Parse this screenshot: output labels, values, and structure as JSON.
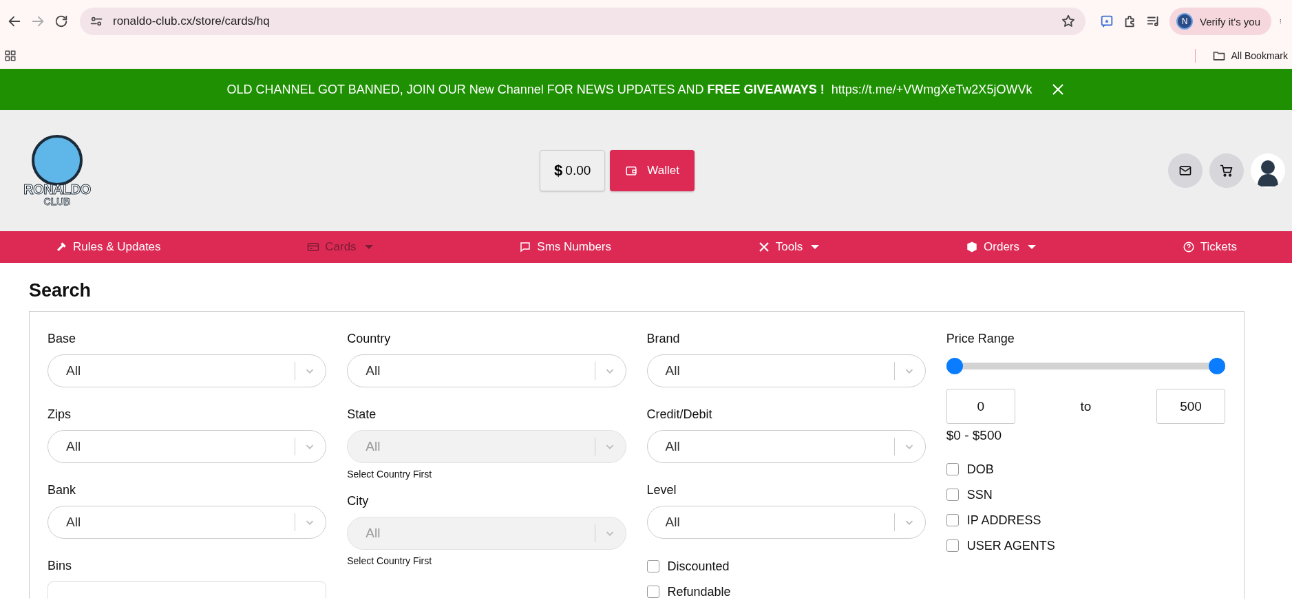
{
  "browser": {
    "url": "ronaldo-club.cx/store/cards/hq",
    "profile": {
      "initial": "N",
      "label": "Verify it's you"
    },
    "bookmarks": [
      {
        "label": "All Bookmark"
      }
    ]
  },
  "banner": {
    "message": "OLD CHANNEL GOT BANNED, JOIN OUR New Channel FOR NEWS UPDATES AND **FREE GIVEAWAYS !**",
    "link": "https://t.me/+VWmgXeTw2X5jOWVk"
  },
  "header": {
    "logo": {
      "title": "RONALDO",
      "subtitle": "CLUB"
    },
    "balance": "**$** 0.00",
    "wallet": "Wallet"
  },
  "nav": [
    {
      "label": "Rules & Updates",
      "selected": false,
      "has_menu": false
    },
    {
      "label": "Cards",
      "selected": true,
      "has_menu": true
    },
    {
      "label": "Sms Numbers",
      "selected": false,
      "has_menu": false
    },
    {
      "label": "Tools",
      "selected": false,
      "has_menu": true
    },
    {
      "label": "Orders",
      "selected": false,
      "has_menu": true
    },
    {
      "label": "Tickets",
      "selected": false,
      "has_menu": false
    }
  ],
  "search": {
    "title": "Search",
    "columns": [
      {
        "fields": [
          {
            "kind": "select",
            "label": "Base",
            "value": "All",
            "disabled": false
          },
          {
            "kind": "select",
            "label": "Zips",
            "value": "All",
            "disabled": false
          },
          {
            "kind": "select",
            "label": "Bank",
            "value": "All",
            "disabled": false
          },
          {
            "kind": "input",
            "label": "Bins"
          }
        ]
      },
      {
        "fields": [
          {
            "kind": "select",
            "label": "Country",
            "value": "All",
            "disabled": false
          },
          {
            "kind": "select",
            "label": "State",
            "value": "All",
            "disabled": true,
            "hint": "Select Country First"
          },
          {
            "kind": "select",
            "label": "City",
            "value": "All",
            "disabled": true,
            "hint": "Select Country First"
          }
        ]
      },
      {
        "fields": [
          {
            "kind": "select",
            "label": "Brand",
            "value": "All",
            "disabled": false
          },
          {
            "kind": "select",
            "label": "Credit/Debit",
            "value": "All",
            "disabled": false
          },
          {
            "kind": "select",
            "label": "Level",
            "value": "All",
            "disabled": false
          },
          {
            "kind": "checkbox",
            "label": "Discounted",
            "checked": false
          },
          {
            "kind": "checkbox",
            "label": "Refundable",
            "checked": false
          }
        ]
      },
      {
        "fields": [
          {
            "kind": "range",
            "label": "Price Range",
            "low": {
              "level": 0,
              "value": "0"
            },
            "high": {
              "level": 1,
              "value": "500"
            },
            "between": "to",
            "summary": "$0 - $500"
          },
          {
            "kind": "checkbox",
            "label": "DOB",
            "checked": false
          },
          {
            "kind": "checkbox",
            "label": "SSN",
            "checked": false
          },
          {
            "kind": "checkbox",
            "label": "IP ADDRESS",
            "checked": false
          },
          {
            "kind": "checkbox",
            "label": "USER AGENTS",
            "checked": false
          }
        ]
      }
    ]
  }
}
